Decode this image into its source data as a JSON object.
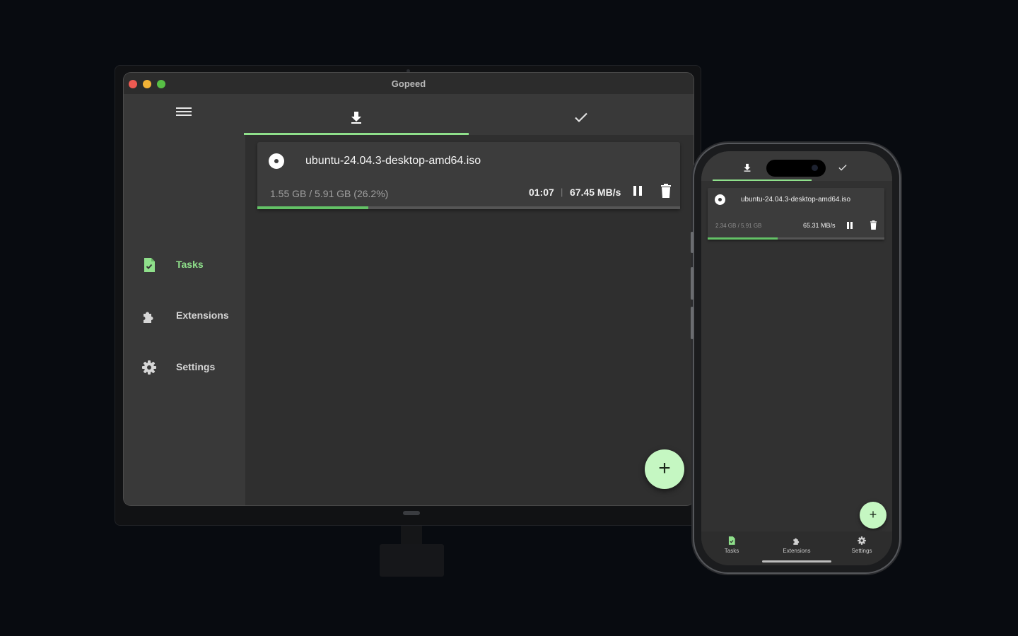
{
  "desktop": {
    "window_title": "Gopeed",
    "sidebar": {
      "items": [
        {
          "label": "Tasks",
          "icon": "task-file-icon",
          "active": true
        },
        {
          "label": "Extensions",
          "icon": "puzzle-icon",
          "active": false
        },
        {
          "label": "Settings",
          "icon": "gear-icon",
          "active": false
        }
      ]
    },
    "tabs": [
      {
        "icon": "download-icon",
        "selected": true
      },
      {
        "icon": "check-icon",
        "selected": false
      }
    ],
    "task": {
      "name": "ubuntu-24.04.3-desktop-amd64.iso",
      "size": "1.55 GB / 5.91 GB (26.2%)",
      "time": "01:07",
      "separator": "|",
      "speed": "67.45 MB/s",
      "progress": 0.262
    },
    "fab_label": "+"
  },
  "mobile": {
    "tabs": [
      {
        "icon": "download-icon",
        "selected": true
      },
      {
        "icon": "check-icon",
        "selected": false
      }
    ],
    "task": {
      "name": "ubuntu-24.04.3-desktop-amd64.iso",
      "size": "2.34 GB / 5.91 GB",
      "speed": "65.31 MB/s",
      "progress": 0.396
    },
    "fab_label": "+",
    "nav": [
      {
        "label": "Tasks",
        "icon": "task-file-icon",
        "active": true
      },
      {
        "label": "Extensions",
        "icon": "puzzle-icon",
        "active": false
      },
      {
        "label": "Settings",
        "icon": "gear-icon",
        "active": false
      }
    ]
  },
  "colors": {
    "accent": "#8fe08b",
    "progress": "#63c266",
    "fab": "#c5f7c2",
    "background": "#080b10"
  }
}
